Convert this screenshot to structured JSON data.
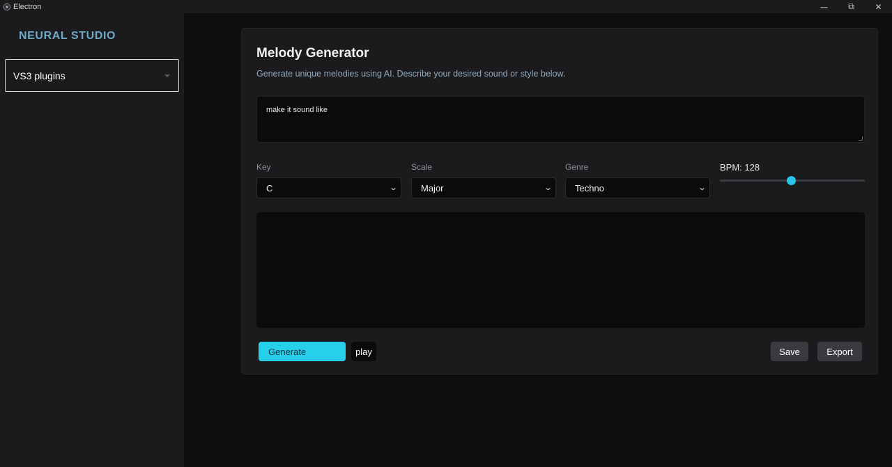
{
  "window": {
    "title": "Electron",
    "controls": {
      "minimize": "─",
      "restore": "⧉",
      "close": "✕"
    }
  },
  "sidebar": {
    "brand": "NEURAL STUDIO",
    "plugin_select": {
      "value": "VS3 plugins"
    }
  },
  "main": {
    "title": "Melody Generator",
    "subtitle": "Generate unique melodies using AI. Describe your desired sound or style below.",
    "prompt": {
      "value": "make it sound like"
    },
    "key": {
      "label": "Key",
      "value": "C"
    },
    "scale": {
      "label": "Scale",
      "value": "Major"
    },
    "genre": {
      "label": "Genre",
      "value": "Techno"
    },
    "bpm": {
      "label": "BPM: 128",
      "value": 128,
      "fill_fraction": 0.49
    },
    "buttons": {
      "generate": "Generate",
      "play": "play",
      "save": "Save",
      "export": "Export"
    }
  },
  "colors": {
    "accent": "#27d0ea",
    "brand": "#6da8c7",
    "background": "#0f0f11",
    "panel": "#1b1b1e"
  }
}
